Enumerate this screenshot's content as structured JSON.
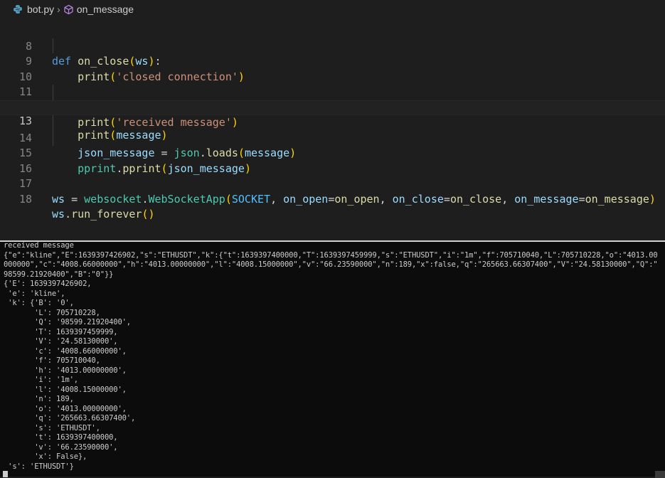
{
  "breadcrumb": {
    "file": "bot.py",
    "symbol": "on_message"
  },
  "editor": {
    "active_line": 13,
    "lines": [
      {
        "n": "8"
      },
      {
        "n": "9"
      },
      {
        "n": "10"
      },
      {
        "n": "11"
      },
      {
        "n": "12"
      },
      {
        "n": "13"
      },
      {
        "n": "14"
      },
      {
        "n": "15"
      },
      {
        "n": "16"
      },
      {
        "n": "17"
      },
      {
        "n": "18"
      }
    ],
    "tokens": {
      "def": "def",
      "on_close": "on_close",
      "ws": "ws",
      "print": "print",
      "closed_connection": "'closed connection'",
      "on_message": "on_message",
      "message": "message",
      "received_message": "'received message'",
      "json_message": "json_message",
      "json": "json",
      "loads": "loads",
      "pprint": "pprint",
      "websocket": "websocket",
      "WebSocketApp": "WebSocketApp",
      "SOCKET": "SOCKET",
      "on_open": "on_open",
      "run_forever": "run_forever"
    }
  },
  "terminal": {
    "lines": [
      "received message",
      "{\"e\":\"kline\",\"E\":1639397426902,\"s\":\"ETHUSDT\",\"k\":{\"t\":1639397400000,\"T\":1639397459999,\"s\":\"ETHUSDT\",\"i\":\"1m\",\"f\":705710040,\"L\":705710228,\"o\":\"4013.00",
      "000000\",\"c\":\"4008.66000000\",\"h\":\"4013.00000000\",\"l\":\"4008.15000000\",\"v\":\"66.23590000\",\"n\":189,\"x\":false,\"q\":\"265663.66307400\",\"V\":\"24.58130000\",\"Q\":\"",
      "98599.21920400\",\"B\":\"0\"}}",
      "{'E': 1639397426902,",
      " 'e': 'kline',",
      " 'k': {'B': '0',",
      "       'L': 705710228,",
      "       'Q': '98599.21920400',",
      "       'T': 1639397459999,",
      "       'V': '24.58130000',",
      "       'c': '4008.66000000',",
      "       'f': 705710040,",
      "       'h': '4013.00000000',",
      "       'i': '1m',",
      "       'l': '4008.15000000',",
      "       'n': 189,",
      "       'o': '4013.00000000',",
      "       'q': '265663.66307400',",
      "       's': 'ETHUSDT',",
      "       't': 1639397400000,",
      "       'v': '66.23590000',",
      "       'x': False},",
      " 's': 'ETHUSDT'}"
    ]
  },
  "colors": {
    "keyword": "#569cd6",
    "function": "#dcdcaa",
    "parameter": "#9cdcfe",
    "string": "#ce9178",
    "class": "#4ec9b0",
    "constant": "#4fc1ff",
    "bracket_gold": "#ffd700",
    "bracket_orchid": "#da70d6"
  },
  "icons": {
    "file": "python-file-icon",
    "symbol": "method-cube-icon",
    "separator": "chevron-right-icon"
  }
}
